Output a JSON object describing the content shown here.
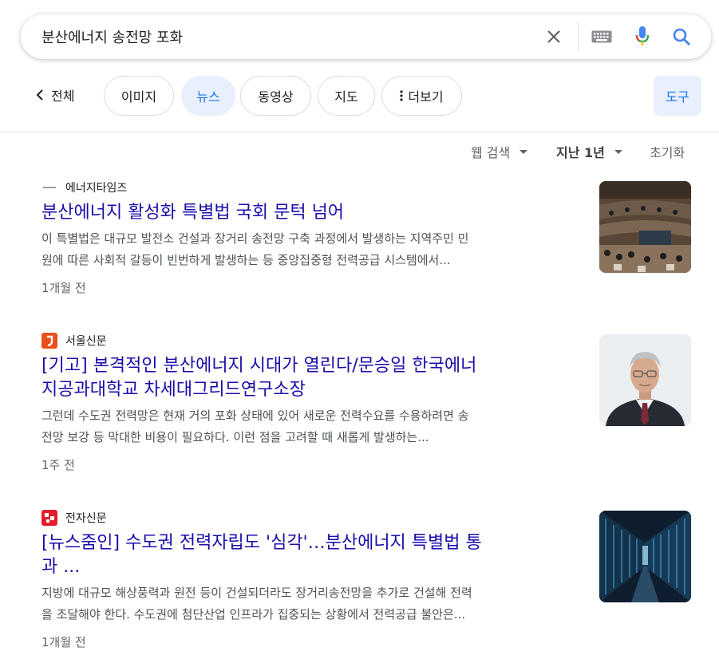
{
  "search": {
    "query": "분산에너지 송전망 포화"
  },
  "tabs": {
    "all_label": "전체",
    "images": "이미지",
    "news": "뉴스",
    "videos": "동영상",
    "maps": "지도",
    "more": "더보기",
    "tools": "도구"
  },
  "filters": {
    "web_search": "웹 검색",
    "period": "지난 1년",
    "reset": "초기화"
  },
  "results": [
    {
      "source": "에너지타임즈",
      "title": "분산에너지 활성화 특별법 국회 문턱 넘어",
      "snippet_line1": "이 특별법은 대규모 발전소 건설과 장거리 송전망 구축 과정에서 발생하는 지역주민 민",
      "snippet_line2": "원에 따른 사회적 갈등이 빈번하게 발생하는 등 중앙집중형 전력공급 시스템에서...",
      "age": "1개월 전"
    },
    {
      "source": "서울신문",
      "title_line1": "[기고] 본격적인 분산에너지 시대가 열린다/문승일 한국에너",
      "title_line2": "지공과대학교 차세대그리드연구소장",
      "snippet_line1": "그런데 수도권 전력망은 현재 거의 포화 상태에 있어 새로운 전력수요를 수용하려면 송",
      "snippet_line2": "전망 보강 등 막대한 비용이 필요하다. 이런 점을 고려할 때 새롭게 발생하는...",
      "age": "1주 전"
    },
    {
      "source": "전자신문",
      "title_line1": "[뉴스줌인] 수도권 전력자립도 '심각'…분산에너지 특별법 통",
      "title_line2": "과 ...",
      "snippet_line1": "지방에 대규모 해상풍력과 원전 등이 건설되더라도 장거리송전망을 추가로 건설해 전력",
      "snippet_line2": "을 조달해야 한다. 수도권에 첨단산업 인프라가 집중되는 상황에서 전력공급 불안은...",
      "age": "1개월 전"
    }
  ],
  "colors": {
    "link": "#1a0dab",
    "accent": "#1a73e8",
    "seoul_favicon": "#e8501d",
    "etnews_favicon": "#e21e2b"
  }
}
